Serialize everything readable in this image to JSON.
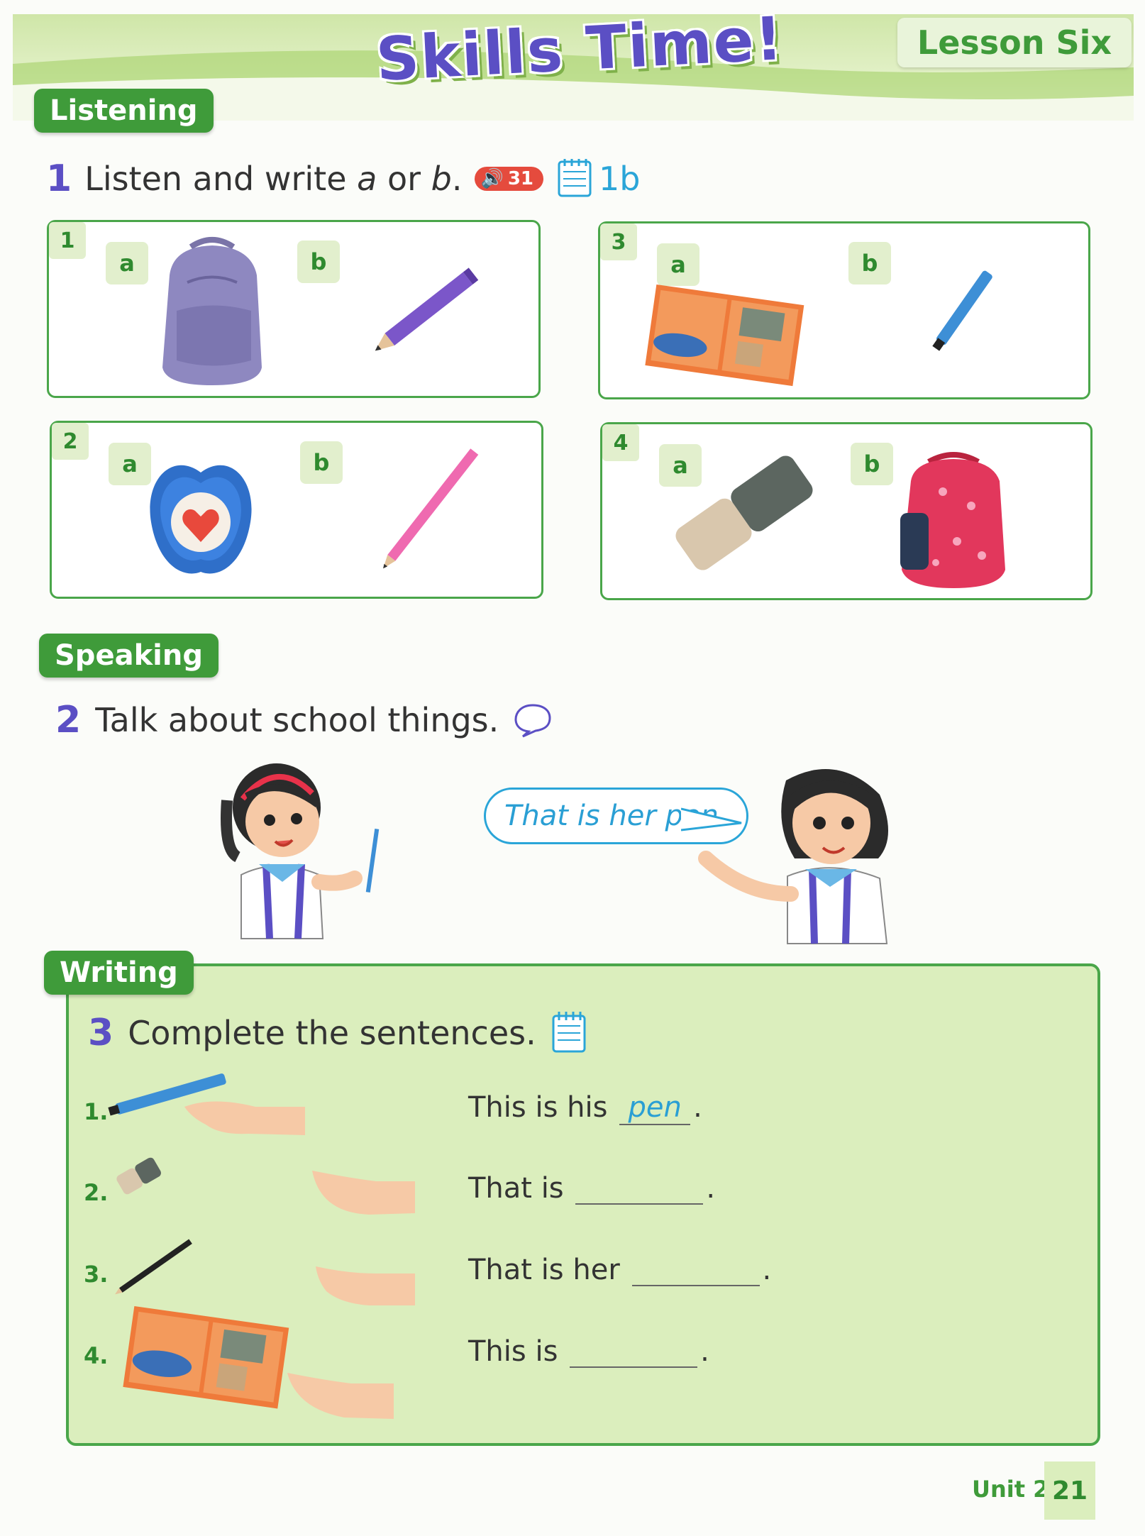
{
  "header": {
    "title": "Skills Time!",
    "lesson": "Lesson Six"
  },
  "listening": {
    "section_label": "Listening",
    "exercise_number": "1",
    "instruction_pre": "Listen and write ",
    "instruction_a": "a",
    "instruction_or": " or ",
    "instruction_b": "b",
    "instruction_end": ".",
    "audio_track": "31",
    "workbook_ref": "1b",
    "items": [
      {
        "number": "1",
        "a": "a",
        "b": "b",
        "a_image": "backpack-icon",
        "b_image": "pencil-icon"
      },
      {
        "number": "3",
        "a": "a",
        "b": "b",
        "a_image": "book-icon",
        "b_image": "pen-icon"
      },
      {
        "number": "2",
        "a": "a",
        "b": "b",
        "a_image": "eraser-icon",
        "b_image": "pencil-icon"
      },
      {
        "number": "4",
        "a": "a",
        "b": "b",
        "a_image": "eraser-icon",
        "b_image": "backpack-icon"
      }
    ]
  },
  "speaking": {
    "section_label": "Speaking",
    "exercise_number": "2",
    "instruction": "Talk about school things.",
    "speech_bubble": "That is her pen."
  },
  "writing": {
    "section_label": "Writing",
    "exercise_number": "3",
    "instruction": "Complete the sentences.",
    "sentences": [
      {
        "num": "1.",
        "text": "This is his",
        "answer": "pen",
        "end": "."
      },
      {
        "num": "2.",
        "text": "That is",
        "answer": "",
        "end": "."
      },
      {
        "num": "3.",
        "text": "That is her",
        "answer": "",
        "end": "."
      },
      {
        "num": "4.",
        "text": "This is",
        "answer": "",
        "end": "."
      }
    ]
  },
  "footer": {
    "unit": "Unit 2",
    "page": "21"
  },
  "colors": {
    "brand_green": "#3f9b3a",
    "purple": "#5b4fc4",
    "blue": "#2aa5d8",
    "audio_red": "#e54b3d"
  }
}
